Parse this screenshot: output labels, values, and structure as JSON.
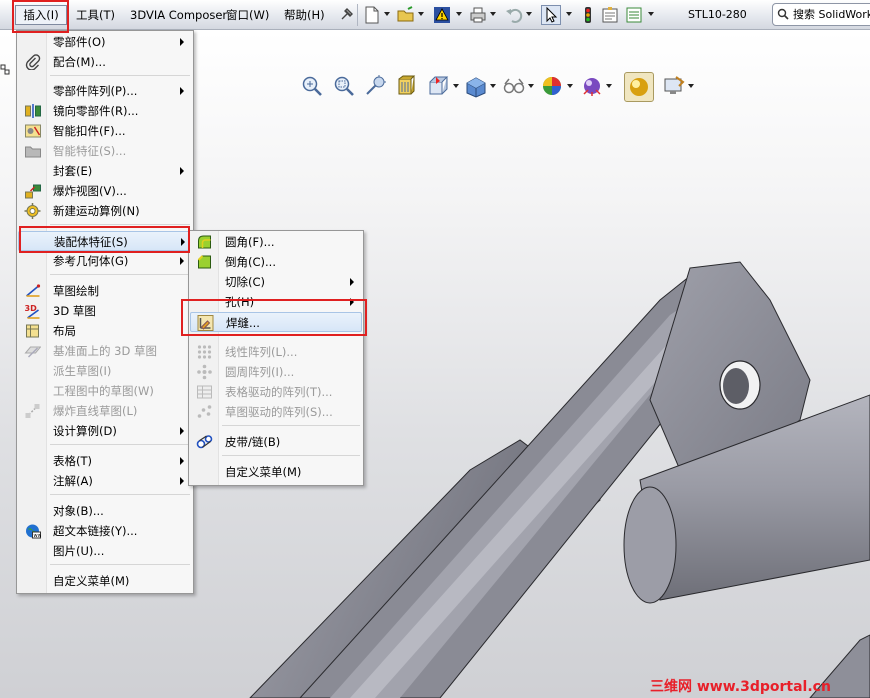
{
  "menubar": {
    "items": [
      "插入(I)",
      "工具(T)",
      "3DVIA Composer",
      "窗口(W)",
      "帮助(H)"
    ],
    "document_title": "STL10-280",
    "search_placeholder": "搜索 SolidWorks"
  },
  "insert_menu": {
    "items": [
      {
        "label": "零部件(O)",
        "submenu": true,
        "disabled": false,
        "icon": "none"
      },
      {
        "label": "配合(M)...",
        "submenu": false,
        "disabled": false,
        "icon": "paperclip-icon"
      },
      {
        "label": "零部件阵列(P)...",
        "submenu": true,
        "disabled": false,
        "icon": "none"
      },
      {
        "label": "镜向零部件(R)...",
        "submenu": false,
        "disabled": false,
        "icon": "mirror-icon"
      },
      {
        "label": "智能扣件(F)...",
        "submenu": false,
        "disabled": false,
        "icon": "fastener-icon"
      },
      {
        "label": "智能特征(S)...",
        "submenu": false,
        "disabled": true,
        "icon": "folder-icon"
      },
      {
        "label": "封套(E)",
        "submenu": true,
        "disabled": false,
        "icon": "none"
      },
      {
        "label": "爆炸视图(V)...",
        "submenu": false,
        "disabled": false,
        "icon": "explode-icon"
      },
      {
        "label": "新建运动算例(N)",
        "submenu": false,
        "disabled": false,
        "icon": "motion-icon"
      },
      {
        "label": "装配体特征(S)",
        "submenu": true,
        "disabled": false,
        "icon": "none"
      },
      {
        "label": "参考几何体(G)",
        "submenu": true,
        "disabled": false,
        "icon": "none"
      },
      {
        "label": "草图绘制",
        "submenu": false,
        "disabled": false,
        "icon": "sketch-icon"
      },
      {
        "label": "3D 草图",
        "submenu": false,
        "disabled": false,
        "icon": "sketch-3d-icon"
      },
      {
        "label": "布局",
        "submenu": false,
        "disabled": false,
        "icon": "layout-icon"
      },
      {
        "label": "基准面上的 3D 草图",
        "submenu": false,
        "disabled": true,
        "icon": "plane-sketch-icon"
      },
      {
        "label": "派生草图(I)",
        "submenu": false,
        "disabled": true,
        "icon": "none"
      },
      {
        "label": "工程图中的草图(W)",
        "submenu": false,
        "disabled": true,
        "icon": "none"
      },
      {
        "label": "爆炸直线草图(L)",
        "submenu": false,
        "disabled": true,
        "icon": "explode-line-icon"
      },
      {
        "label": "设计算例(D)",
        "submenu": true,
        "disabled": false,
        "icon": "none"
      },
      {
        "label": "表格(T)",
        "submenu": true,
        "disabled": false,
        "icon": "none"
      },
      {
        "label": "注解(A)",
        "submenu": true,
        "disabled": false,
        "icon": "none"
      },
      {
        "label": "对象(B)...",
        "submenu": false,
        "disabled": false,
        "icon": "none"
      },
      {
        "label": "超文本链接(Y)...",
        "submenu": false,
        "disabled": false,
        "icon": "globe-icon"
      },
      {
        "label": "图片(U)...",
        "submenu": false,
        "disabled": false,
        "icon": "none"
      },
      {
        "label": "自定义菜单(M)",
        "submenu": false,
        "disabled": false,
        "icon": "none"
      }
    ]
  },
  "assembly_features_menu": {
    "items": [
      {
        "label": "圆角(F)...",
        "submenu": false,
        "disabled": false,
        "icon": "fillet-icon"
      },
      {
        "label": "倒角(C)...",
        "submenu": false,
        "disabled": false,
        "icon": "chamfer-icon"
      },
      {
        "label": "切除(C)",
        "submenu": true,
        "disabled": false,
        "icon": "none"
      },
      {
        "label": "孔(H)",
        "submenu": true,
        "disabled": false,
        "icon": "none"
      },
      {
        "label": "焊缝...",
        "submenu": false,
        "disabled": false,
        "icon": "weld-bead-icon"
      },
      {
        "label": "线性阵列(L)...",
        "submenu": false,
        "disabled": true,
        "icon": "linear-pattern-icon"
      },
      {
        "label": "圆周阵列(I)...",
        "submenu": false,
        "disabled": true,
        "icon": "circular-pattern-icon"
      },
      {
        "label": "表格驱动的阵列(T)...",
        "submenu": false,
        "disabled": true,
        "icon": "table-pattern-icon"
      },
      {
        "label": "草图驱动的阵列(S)...",
        "submenu": false,
        "disabled": true,
        "icon": "sketch-pattern-icon"
      },
      {
        "label": "皮带/链(B)",
        "submenu": false,
        "disabled": false,
        "icon": "belt-chain-icon"
      },
      {
        "label": "自定义菜单(M)",
        "submenu": false,
        "disabled": false,
        "icon": "none"
      }
    ]
  },
  "watermark": "三维网 www.3dportal.cn",
  "colors": {
    "highlight_red": "#e02020",
    "menu_bg": "#f7f7f7",
    "model_gray": "#8f9098"
  }
}
